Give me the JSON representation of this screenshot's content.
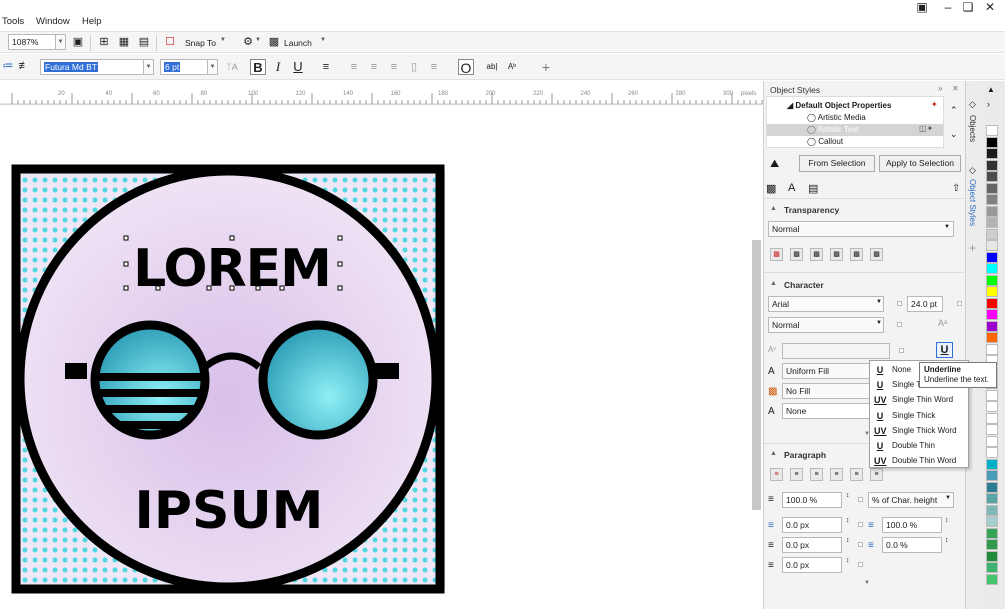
{
  "menu": [
    "Tools",
    "Window",
    "Help"
  ],
  "window_controls": [
    "user-icon",
    "restore-icon",
    "close-icon"
  ],
  "standard_toolbar": {
    "zoom_value": "1087%",
    "snap_to_label": "Snap To",
    "launch_label": "Launch"
  },
  "property_bar": {
    "font_name": "Futura Md BT",
    "font_size": "6 pt"
  },
  "ruler_ticks": [
    "20",
    "40",
    "60",
    "80",
    "100",
    "120",
    "140",
    "160",
    "180",
    "200",
    "220",
    "240",
    "260",
    "280",
    "300"
  ],
  "ruler_unit": "pixels",
  "artwork": {
    "text_top": "LOREM",
    "text_bottom": "IPSUM",
    "colors": {
      "frame": "#000000",
      "circle_fill": "#e9d6f1",
      "dots": "#3fd7e0",
      "lens": "#3db6c9"
    }
  },
  "docker": {
    "title": "Object Styles",
    "tree": {
      "root": "Default Object Properties",
      "items": [
        "Artistic Media",
        "Artistic Text",
        "Callout"
      ],
      "selected": "Artistic Text"
    },
    "buttons": {
      "from_selection": "From Selection",
      "apply_to_selection": "Apply to Selection"
    },
    "transparency": {
      "title": "Transparency",
      "mode": "Normal"
    },
    "character": {
      "title": "Character",
      "font": "Arial",
      "size": "24.0 pt",
      "style": "Normal",
      "fill": "Uniform Fill",
      "background_fill": "No Fill",
      "outline": "None"
    },
    "paragraph": {
      "title": "Paragraph",
      "line_spacing": "100.0 %",
      "line_spacing_unit": "% of Char. height",
      "before_paragraph": "0.0 px",
      "char_spacing": "100.0 %",
      "after_paragraph": "0.0 px",
      "word_spacing": "0.0 %",
      "indent": "0.0 px"
    }
  },
  "underline_menu": [
    "None",
    "Single Thin",
    "Single Thin Word",
    "Single Thick",
    "Single Thick Word",
    "Double Thin",
    "Double Thin Word"
  ],
  "tooltip": {
    "title": "Underline",
    "text": "Underline the text."
  },
  "side_tabs": [
    "Objects",
    "Object Styles"
  ],
  "palette_colors": [
    "#ffffff",
    "#000000",
    "#1a1a1a",
    "#333333",
    "#4d4d4d",
    "#666666",
    "#808080",
    "#999999",
    "#b3b3b3",
    "#cccccc",
    "#e6e6e6",
    "#0000ff",
    "#00ffff",
    "#00ff00",
    "#ffff00",
    "#ff0000",
    "#ff00ff",
    "#9900cc",
    "#ff6600",
    "#ffffff",
    "#ffffff",
    "#ffffff",
    "#ffffff",
    "#ffffff",
    "#ffffff",
    "#ffffff",
    "#ffffff",
    "#ffffff",
    "#ffffff",
    "#00b0c8",
    "#4a9bb5",
    "#2d7d90",
    "#5aa5a5",
    "#7fb8b8",
    "#a5cfcf",
    "#33a355",
    "#2e9948",
    "#1f8a3a",
    "#3cb371",
    "#45c56f"
  ]
}
